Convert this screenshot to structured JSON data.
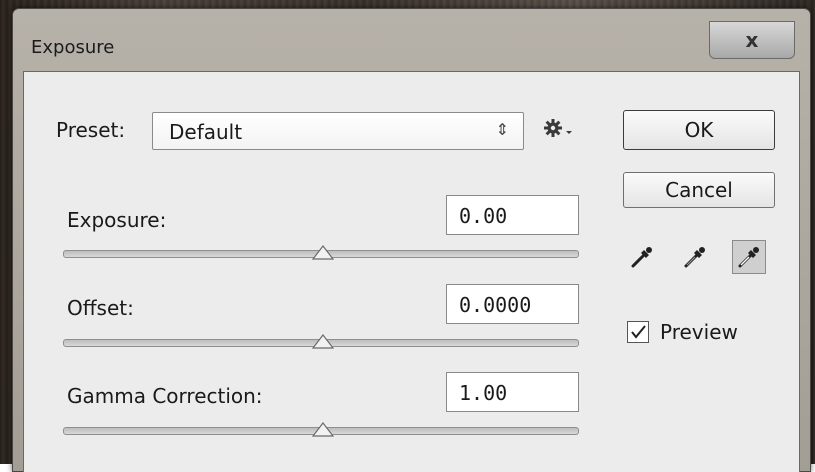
{
  "dialog": {
    "title": "Exposure",
    "close_label": "x"
  },
  "preset": {
    "label": "Preset:",
    "value": "Default"
  },
  "buttons": {
    "ok": "OK",
    "cancel": "Cancel"
  },
  "sliders": [
    {
      "label": "Exposure:",
      "value": "0.00",
      "position": 0.5
    },
    {
      "label": "Offset:",
      "value": "0.0000",
      "position": 0.5
    },
    {
      "label": "Gamma Correction:",
      "value": "1.00",
      "position": 0.5
    }
  ],
  "preview": {
    "label": "Preview",
    "checked": true
  },
  "tools": {
    "active_eyedropper": "white-point"
  }
}
